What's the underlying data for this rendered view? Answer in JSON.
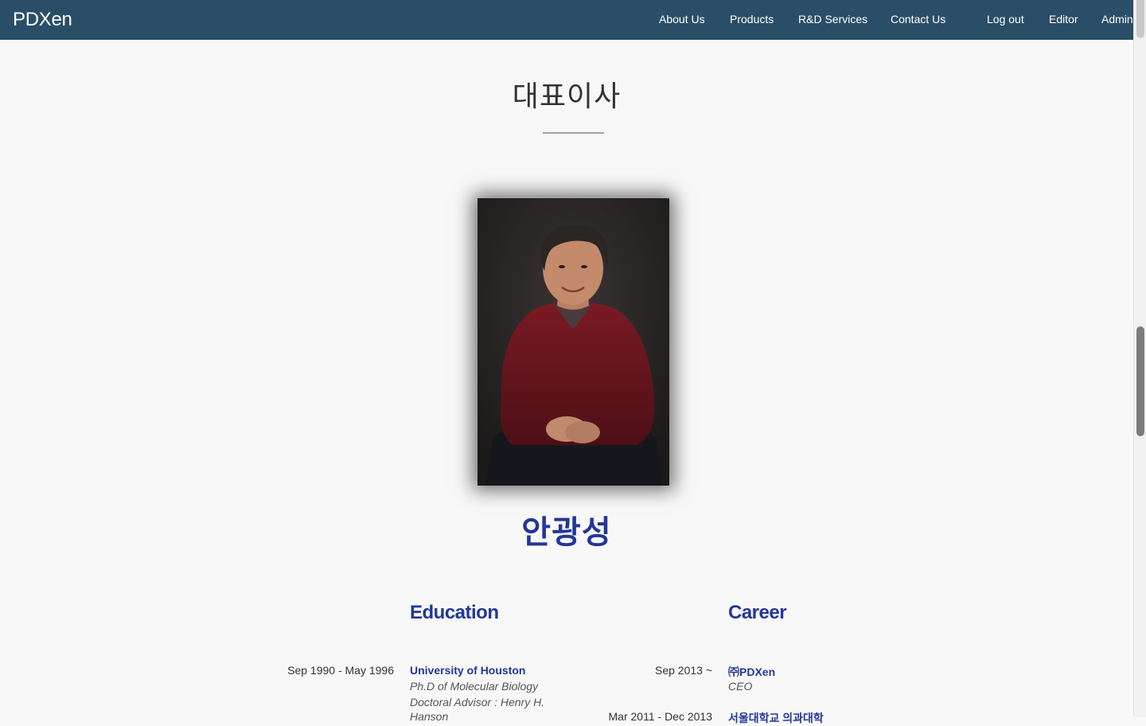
{
  "navbar": {
    "brand": "PDXen",
    "links": [
      {
        "label": "About Us"
      },
      {
        "label": "Products"
      },
      {
        "label": "R&D Services"
      },
      {
        "label": "Contact Us"
      }
    ],
    "account_links": [
      {
        "label": "Log out"
      },
      {
        "label": "Editor"
      },
      {
        "label": "Admin"
      }
    ],
    "background": "#2a4e67"
  },
  "page": {
    "title": "대표이사",
    "person_name": "안광성",
    "accent": "#22379a"
  },
  "education": {
    "heading": "Education",
    "entries": [
      {
        "date": "Sep 1990 - May 1996",
        "institution": "University of Houston",
        "degree": "Ph.D of Molecular Biology",
        "advisor": "Doctoral Advisor : Henry H.",
        "advisor_cont": "Hanson"
      }
    ]
  },
  "career": {
    "heading": "Career",
    "entries": [
      {
        "date": "Sep 2013 ~",
        "organization": "㈜PDXen",
        "role": "CEO"
      },
      {
        "date": "Mar 2011 - Dec 2013",
        "organization": "서울대학교 의과대학"
      }
    ]
  }
}
